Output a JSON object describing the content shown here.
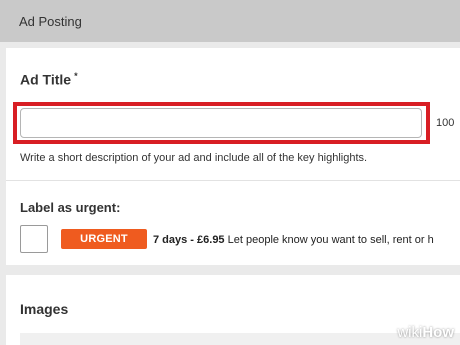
{
  "header": {
    "title": "Ad Posting"
  },
  "ad_title": {
    "label": "Ad Title",
    "required_marker": "*",
    "input_value": "",
    "char_limit": "100",
    "hint": "Write a short description of your ad and include all of the key highlights."
  },
  "urgent": {
    "heading": "Label as urgent:",
    "badge_label": "URGENT",
    "price_label": "7 days - £6.95",
    "description": "Let people know you want to sell, rent or h",
    "checked": false
  },
  "images": {
    "heading": "Images"
  },
  "watermark": {
    "wiki": "wiki",
    "how": "How"
  },
  "colors": {
    "highlight": "#d81e24",
    "urgent_badge": "#ef5b1f",
    "header_bg": "#c9c9c9",
    "page_bg": "#eaeaea"
  }
}
